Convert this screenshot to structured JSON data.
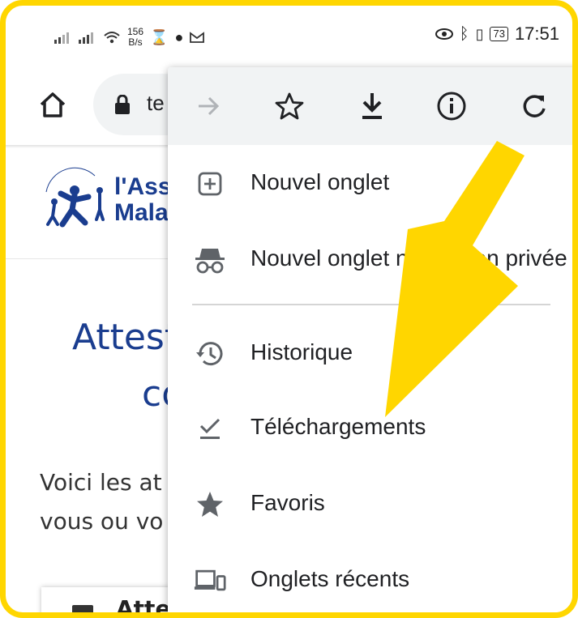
{
  "status_bar": {
    "net_speed_value": "156",
    "net_speed_unit": "B/s",
    "battery": "73",
    "time": "17:51"
  },
  "toolbar": {
    "url_partial": "te"
  },
  "page": {
    "logo_line1": "l'Ass",
    "logo_line2": "Mala",
    "title_line1": "Attest",
    "title_line2": "co",
    "body_line1": "Voici les at",
    "body_line2": "vous ou vo",
    "card_title": "Atte"
  },
  "menu": {
    "icons": [
      "forward-icon",
      "star-icon",
      "download-icon",
      "info-icon",
      "refresh-icon"
    ],
    "items": [
      {
        "label": "Nouvel onglet",
        "icon": "new-tab-icon"
      },
      {
        "label": "Nouvel onglet navigation privée",
        "icon": "incognito-icon"
      },
      {
        "label": "Historique",
        "icon": "history-icon"
      },
      {
        "label": "Téléchargements",
        "icon": "downloads-check-icon"
      },
      {
        "label": "Favoris",
        "icon": "star-filled-icon"
      },
      {
        "label": "Onglets récents",
        "icon": "devices-icon"
      }
    ]
  },
  "colors": {
    "highlight": "#ffd600",
    "brand_blue": "#1a3d8f",
    "menu_icon": "#5f6368"
  }
}
